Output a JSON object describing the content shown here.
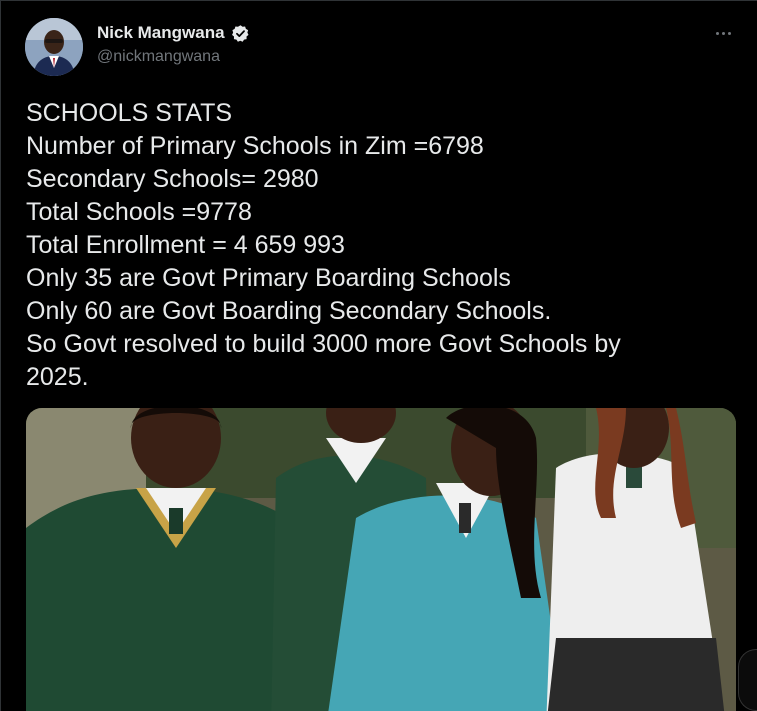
{
  "author": {
    "display_name": "Nick Mangwana",
    "handle": "@nickmangwana",
    "verified": true,
    "avatar_icon": "user-avatar-photo"
  },
  "menu": {
    "icon": "more-horizontal-icon"
  },
  "tweet": {
    "lines": [
      "SCHOOLS STATS",
      "Number of Primary Schools in Zim =6798",
      "Secondary Schools= 2980",
      "Total Schools =9778",
      "Total Enrollment = 4 659 993",
      "Only 35 are Govt Primary Boarding Schools",
      "Only 60 are Govt Boarding Secondary Schools.",
      "So Govt resolved to build 3000 more Govt Schools by",
      "2025."
    ]
  },
  "media": {
    "kind": "photo",
    "subject": "students-in-school-uniforms"
  },
  "colors": {
    "background": "#000000",
    "text_primary": "#e7e9ea",
    "text_secondary": "#71767b",
    "verified_badge": "#e7e9ea"
  }
}
